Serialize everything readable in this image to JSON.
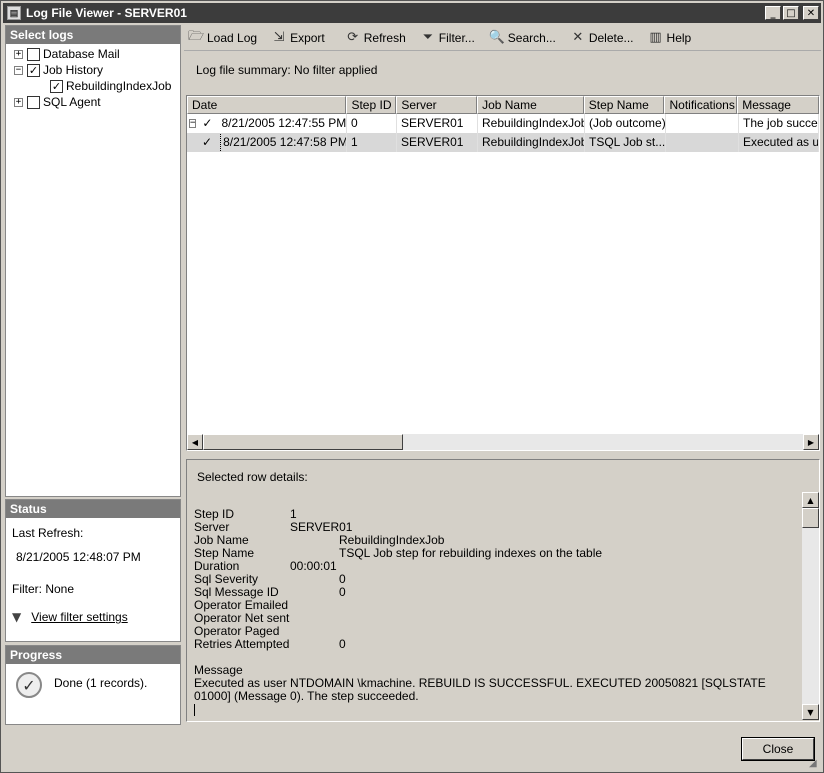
{
  "window": {
    "title": "Log File Viewer - SERVER01",
    "controls": {
      "minimize": "_",
      "maximize": "□",
      "close": "✕"
    }
  },
  "left": {
    "select_logs": {
      "header": "Select logs",
      "items": [
        {
          "label": "Database Mail",
          "checked": false,
          "expander": "+"
        },
        {
          "label": "Job History",
          "checked": true,
          "expander": "−"
        },
        {
          "label": "RebuildingIndexJob",
          "checked": true
        },
        {
          "label": "SQL Agent",
          "checked": false,
          "expander": "+"
        }
      ]
    },
    "status": {
      "header": "Status",
      "last_refresh_label": "Last Refresh:",
      "last_refresh_value": "8/21/2005 12:48:07 PM",
      "filter_label": "Filter: None",
      "view_filter_link": "View filter settings"
    },
    "progress": {
      "header": "Progress",
      "message": "Done (1 records)."
    }
  },
  "toolbar": {
    "load_log": "Load Log",
    "export": "Export",
    "refresh": "Refresh",
    "filter": "Filter...",
    "search": "Search...",
    "delete": "Delete...",
    "help": "Help"
  },
  "summary": "Log file summary: No filter applied",
  "grid": {
    "columns": [
      "Date",
      "Step ID",
      "Server",
      "Job Name",
      "Step Name",
      "Notifications",
      "Message"
    ],
    "rows": [
      {
        "expander": "−",
        "date": "8/21/2005 12:47:55 PM",
        "step_id": "0",
        "server": "SERVER01",
        "job_name": "RebuildingIndexJob",
        "step_name": "(Job outcome)",
        "notifications": "",
        "message": "The job succee"
      },
      {
        "expander": "",
        "date": "8/21/2005 12:47:58 PM",
        "step_id": "1",
        "server": "SERVER01",
        "job_name": "RebuildingIndexJob",
        "step_name": "TSQL Job st...",
        "notifications": "",
        "message": "Executed as us"
      }
    ]
  },
  "details": {
    "title": "Selected row details:",
    "fields": [
      {
        "key": "Step ID",
        "value": "1"
      },
      {
        "key": "Server",
        "value": "SERVER01"
      },
      {
        "key": "Job Name",
        "value": "RebuildingIndexJob"
      },
      {
        "key": "Step Name",
        "value": "TSQL Job step for rebuilding indexes on the table"
      },
      {
        "key": "Duration",
        "value": "00:00:01"
      },
      {
        "key": "Sql Severity",
        "value": "0"
      },
      {
        "key": "Sql Message ID",
        "value": "0"
      },
      {
        "key": "Operator Emailed",
        "value": ""
      },
      {
        "key": "Operator Net sent",
        "value": ""
      },
      {
        "key": "Operator Paged",
        "value": ""
      },
      {
        "key": "Retries Attempted",
        "value": "0"
      }
    ],
    "message_label": "Message",
    "message_text": "Executed as user  NTDOMAIN \\kmachine. REBUILD IS SUCCESSFUL. EXECUTED 20050821 [SQLSTATE 01000] (Message 0).  The step succeeded."
  },
  "close_button": "Close"
}
